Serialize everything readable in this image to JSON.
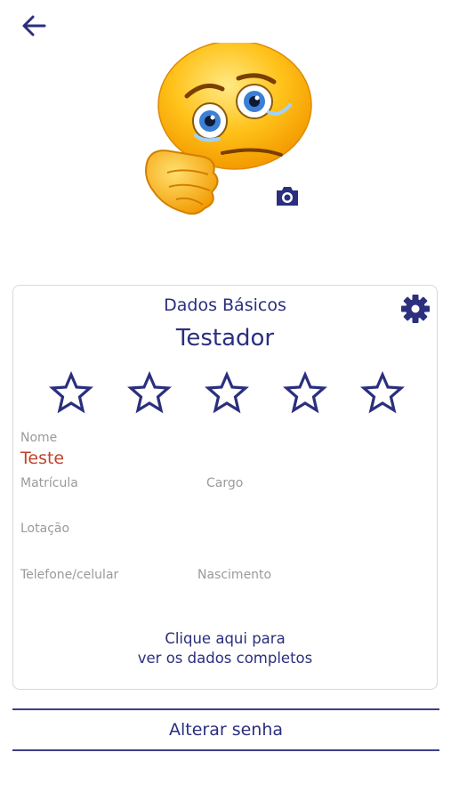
{
  "header": {
    "back_icon": "arrow-left-icon"
  },
  "profile": {
    "avatar": "sad-emoji-avatar",
    "camera_icon": "camera-icon"
  },
  "card": {
    "title": "Dados Básicos",
    "settings_icon": "gear-icon",
    "user_name": "Testador",
    "rating": {
      "max": 5,
      "value": 0,
      "icon": "star-outline-icon"
    },
    "fields": {
      "nome": {
        "label": "Nome",
        "value": "Teste"
      },
      "matricula": {
        "label": "Matrícula",
        "value": ""
      },
      "cargo": {
        "label": "Cargo",
        "value": ""
      },
      "lotacao": {
        "label": "Lotação",
        "value": ""
      },
      "telefone": {
        "label": "Telefone/celular",
        "value": ""
      },
      "nascimento": {
        "label": "Nascimento",
        "value": ""
      }
    },
    "details_link": {
      "line1": "Clique aqui para",
      "line2": "ver os dados completos"
    }
  },
  "change_password": {
    "label": "Alterar senha"
  },
  "colors": {
    "accent": "#2b2f7e",
    "value_text": "#c0432b",
    "label_text": "#9a9a9a",
    "border": "#d8d8d8"
  }
}
